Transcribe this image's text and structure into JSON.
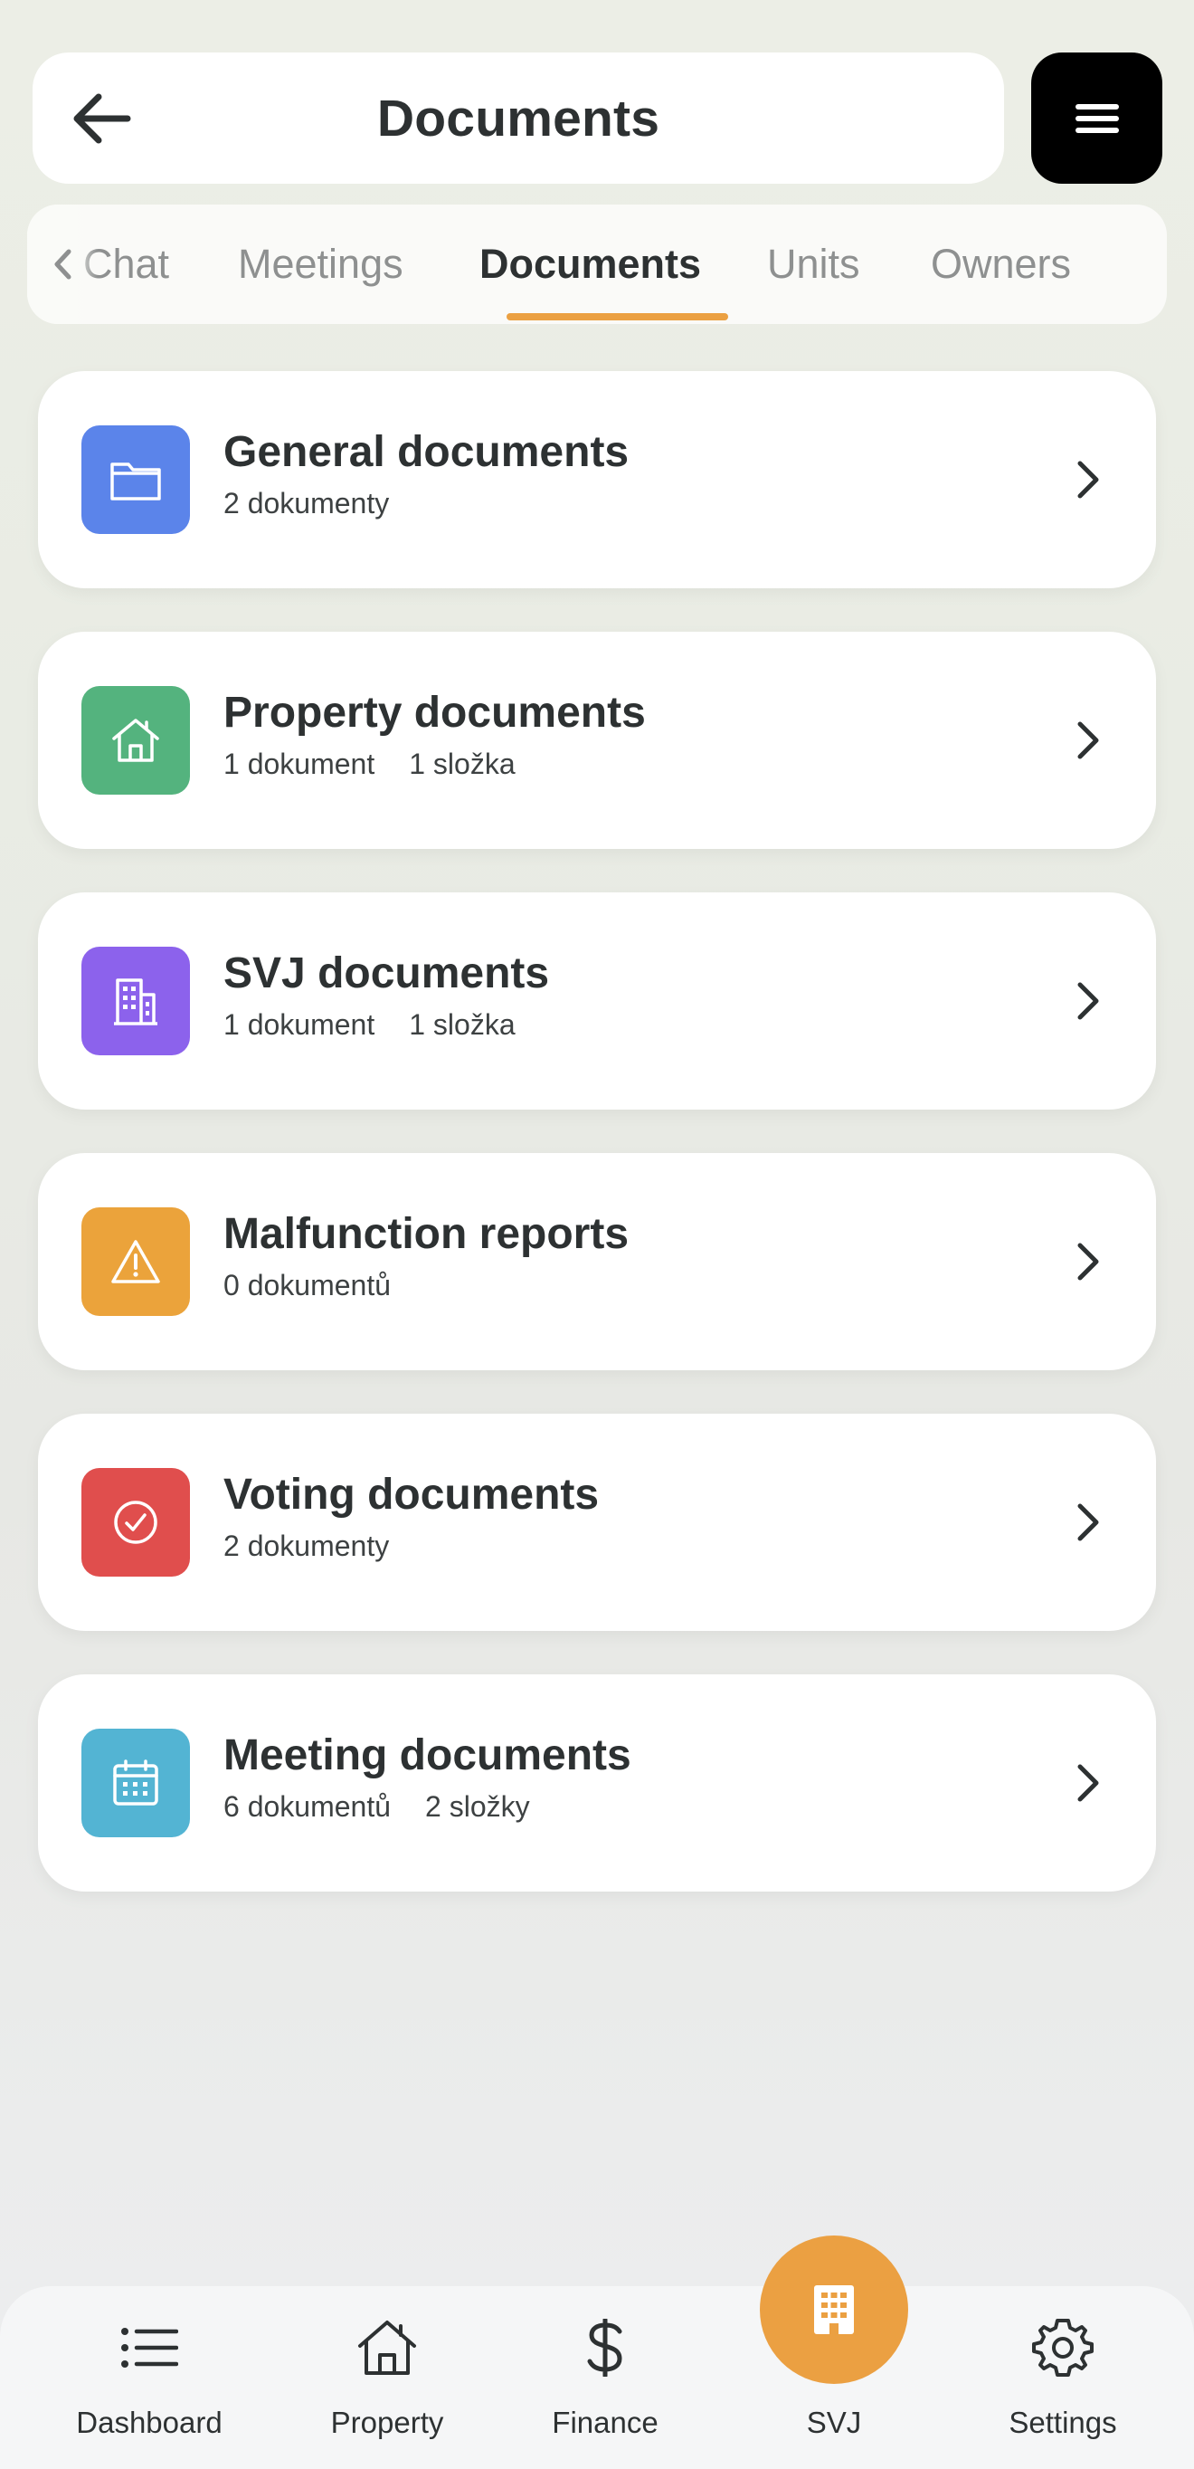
{
  "header": {
    "title": "Documents"
  },
  "tabs": [
    {
      "label": "Chat"
    },
    {
      "label": "Meetings"
    },
    {
      "label": "Documents",
      "active": true
    },
    {
      "label": "Units"
    },
    {
      "label": "Owners"
    }
  ],
  "categories": [
    {
      "title": "General documents",
      "meta": [
        "2 dokumenty"
      ],
      "color": "#5b84ea",
      "icon": "folder-icon"
    },
    {
      "title": "Property documents",
      "meta": [
        "1 dokument",
        "1 složka"
      ],
      "color": "#54b37e",
      "icon": "house-icon"
    },
    {
      "title": "SVJ documents",
      "meta": [
        "1 dokument",
        "1 složka"
      ],
      "color": "#8c62ec",
      "icon": "building-icon"
    },
    {
      "title": "Malfunction reports",
      "meta": [
        "0 dokumentů"
      ],
      "color": "#eba33b",
      "icon": "warning-icon"
    },
    {
      "title": "Voting documents",
      "meta": [
        "2 dokumenty"
      ],
      "color": "#e04e4d",
      "icon": "check-circle-icon"
    },
    {
      "title": "Meeting documents",
      "meta": [
        "6 dokumentů",
        "2 složky"
      ],
      "color": "#53b4d3",
      "icon": "calendar-icon"
    }
  ],
  "nav": {
    "dashboard": "Dashboard",
    "property": "Property",
    "finance": "Finance",
    "svj": "SVJ",
    "settings": "Settings"
  },
  "colors": {
    "accent": "#eba042",
    "text": "#2d3132",
    "inactive_tab": "#8e9090"
  }
}
